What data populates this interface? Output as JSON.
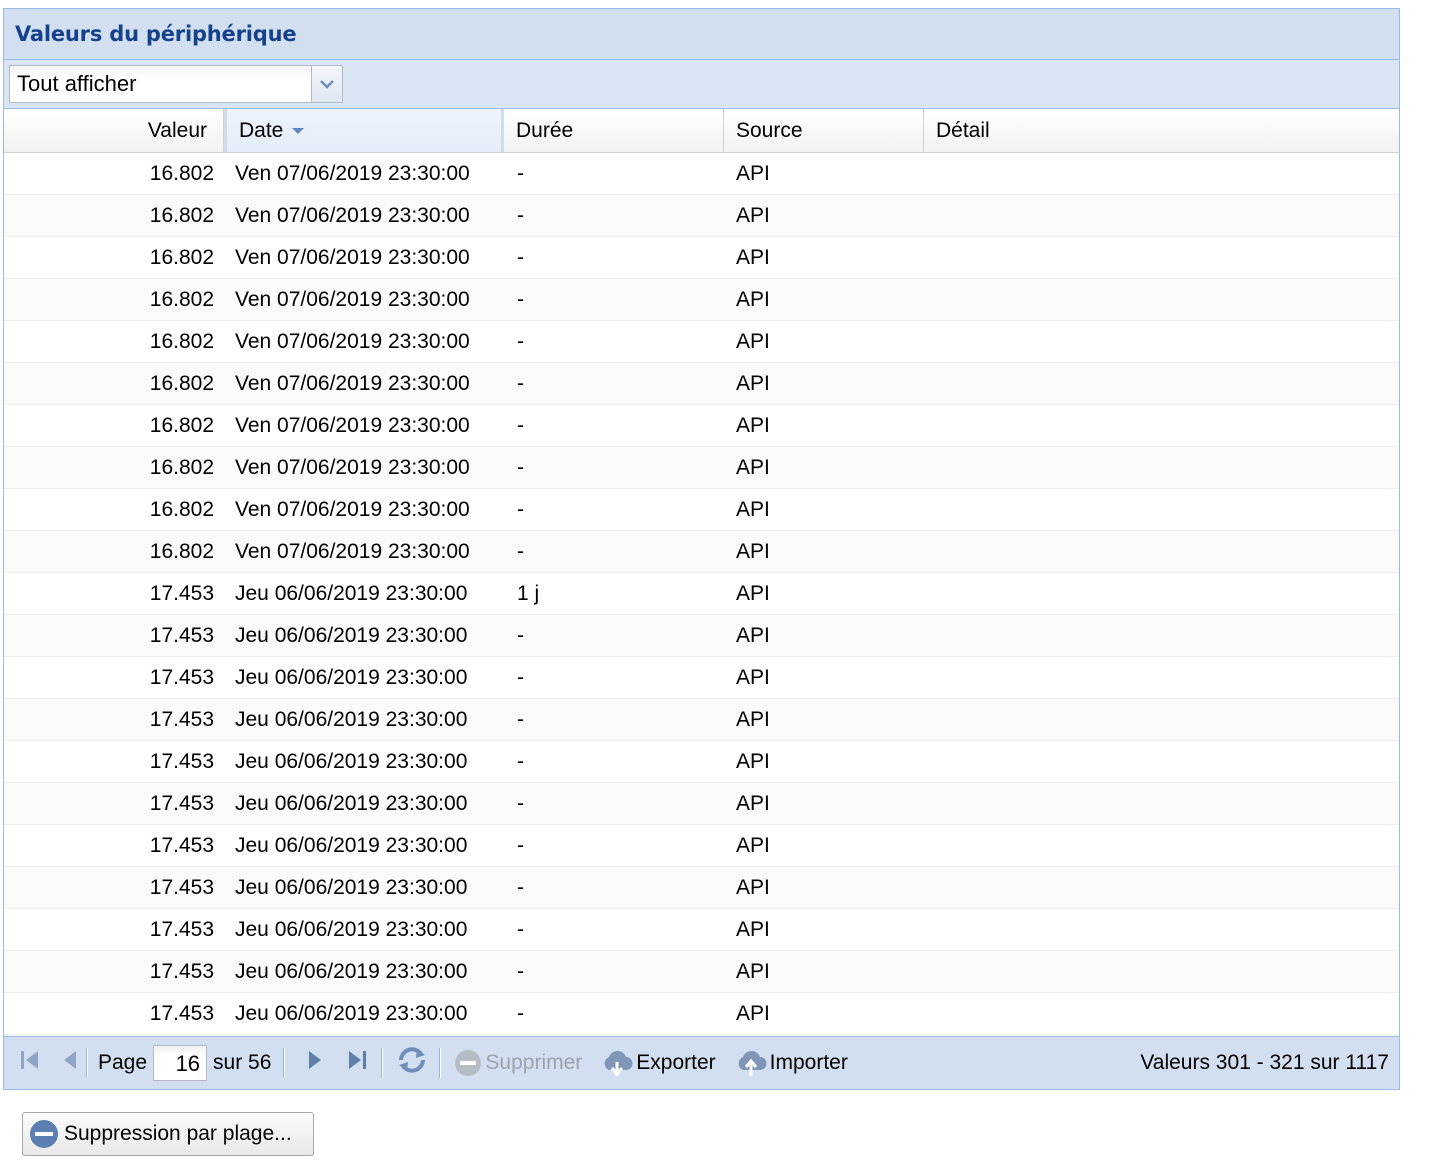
{
  "panel": {
    "title": "Valeurs du périphérique"
  },
  "filter": {
    "selected": "Tout afficher"
  },
  "grid": {
    "columns": [
      "Valeur",
      "Date",
      "Durée",
      "Source",
      "Détail"
    ],
    "sorted_column": "Date",
    "rows": [
      {
        "valeur": "16.802",
        "date": "Ven 07/06/2019 23:30:00",
        "duree": "-",
        "source": "API",
        "detail": ""
      },
      {
        "valeur": "16.802",
        "date": "Ven 07/06/2019 23:30:00",
        "duree": "-",
        "source": "API",
        "detail": ""
      },
      {
        "valeur": "16.802",
        "date": "Ven 07/06/2019 23:30:00",
        "duree": "-",
        "source": "API",
        "detail": ""
      },
      {
        "valeur": "16.802",
        "date": "Ven 07/06/2019 23:30:00",
        "duree": "-",
        "source": "API",
        "detail": ""
      },
      {
        "valeur": "16.802",
        "date": "Ven 07/06/2019 23:30:00",
        "duree": "-",
        "source": "API",
        "detail": ""
      },
      {
        "valeur": "16.802",
        "date": "Ven 07/06/2019 23:30:00",
        "duree": "-",
        "source": "API",
        "detail": ""
      },
      {
        "valeur": "16.802",
        "date": "Ven 07/06/2019 23:30:00",
        "duree": "-",
        "source": "API",
        "detail": ""
      },
      {
        "valeur": "16.802",
        "date": "Ven 07/06/2019 23:30:00",
        "duree": "-",
        "source": "API",
        "detail": ""
      },
      {
        "valeur": "16.802",
        "date": "Ven 07/06/2019 23:30:00",
        "duree": "-",
        "source": "API",
        "detail": ""
      },
      {
        "valeur": "16.802",
        "date": "Ven 07/06/2019 23:30:00",
        "duree": "-",
        "source": "API",
        "detail": ""
      },
      {
        "valeur": "17.453",
        "date": "Jeu 06/06/2019 23:30:00",
        "duree": "1 j",
        "source": "API",
        "detail": ""
      },
      {
        "valeur": "17.453",
        "date": "Jeu 06/06/2019 23:30:00",
        "duree": "-",
        "source": "API",
        "detail": ""
      },
      {
        "valeur": "17.453",
        "date": "Jeu 06/06/2019 23:30:00",
        "duree": "-",
        "source": "API",
        "detail": ""
      },
      {
        "valeur": "17.453",
        "date": "Jeu 06/06/2019 23:30:00",
        "duree": "-",
        "source": "API",
        "detail": ""
      },
      {
        "valeur": "17.453",
        "date": "Jeu 06/06/2019 23:30:00",
        "duree": "-",
        "source": "API",
        "detail": ""
      },
      {
        "valeur": "17.453",
        "date": "Jeu 06/06/2019 23:30:00",
        "duree": "-",
        "source": "API",
        "detail": ""
      },
      {
        "valeur": "17.453",
        "date": "Jeu 06/06/2019 23:30:00",
        "duree": "-",
        "source": "API",
        "detail": ""
      },
      {
        "valeur": "17.453",
        "date": "Jeu 06/06/2019 23:30:00",
        "duree": "-",
        "source": "API",
        "detail": ""
      },
      {
        "valeur": "17.453",
        "date": "Jeu 06/06/2019 23:30:00",
        "duree": "-",
        "source": "API",
        "detail": ""
      },
      {
        "valeur": "17.453",
        "date": "Jeu 06/06/2019 23:30:00",
        "duree": "-",
        "source": "API",
        "detail": ""
      },
      {
        "valeur": "17.453",
        "date": "Jeu 06/06/2019 23:30:00",
        "duree": "-",
        "source": "API",
        "detail": ""
      }
    ]
  },
  "pager": {
    "page_label": "Page",
    "page_value": "16",
    "of_label": "sur 56",
    "delete_label": "Supprimer",
    "export_label": "Exporter",
    "import_label": "Importer",
    "status": "Valeurs 301 - 321 sur 1117",
    "icons": [
      "first-page-icon",
      "prev-page-icon",
      "next-page-icon",
      "last-page-icon",
      "refresh-icon",
      "delete-icon",
      "export-cloud-icon",
      "import-cloud-icon"
    ]
  },
  "range_delete": {
    "label": "Suppression par plage..."
  },
  "colors": {
    "header_bg": "#d2dff0",
    "title": "#15428b",
    "border": "#99bbe8"
  }
}
